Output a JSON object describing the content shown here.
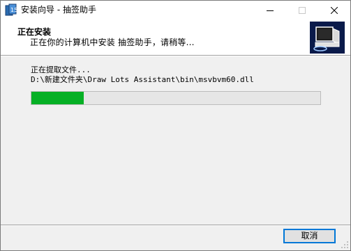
{
  "window": {
    "title": "安装向导 - 抽签助手",
    "app_icon": "installer-icon"
  },
  "header": {
    "title": "正在安装",
    "subtitle": "正在你的计算机中安装 抽签助手，请稍等...",
    "logo_icon": "computer-install-icon"
  },
  "main": {
    "status_text": "正在提取文件...",
    "current_file": "D:\\新建文件夹\\Draw Lots Assistant\\bin\\msvbvm60.dll",
    "progress_percent": 18
  },
  "footer": {
    "cancel_label": "取消"
  },
  "colors": {
    "progress_fill": "#06b025",
    "progress_track": "#e6e6e6",
    "focus_border": "#0078d7",
    "logo_background": "#0a1a4a"
  }
}
